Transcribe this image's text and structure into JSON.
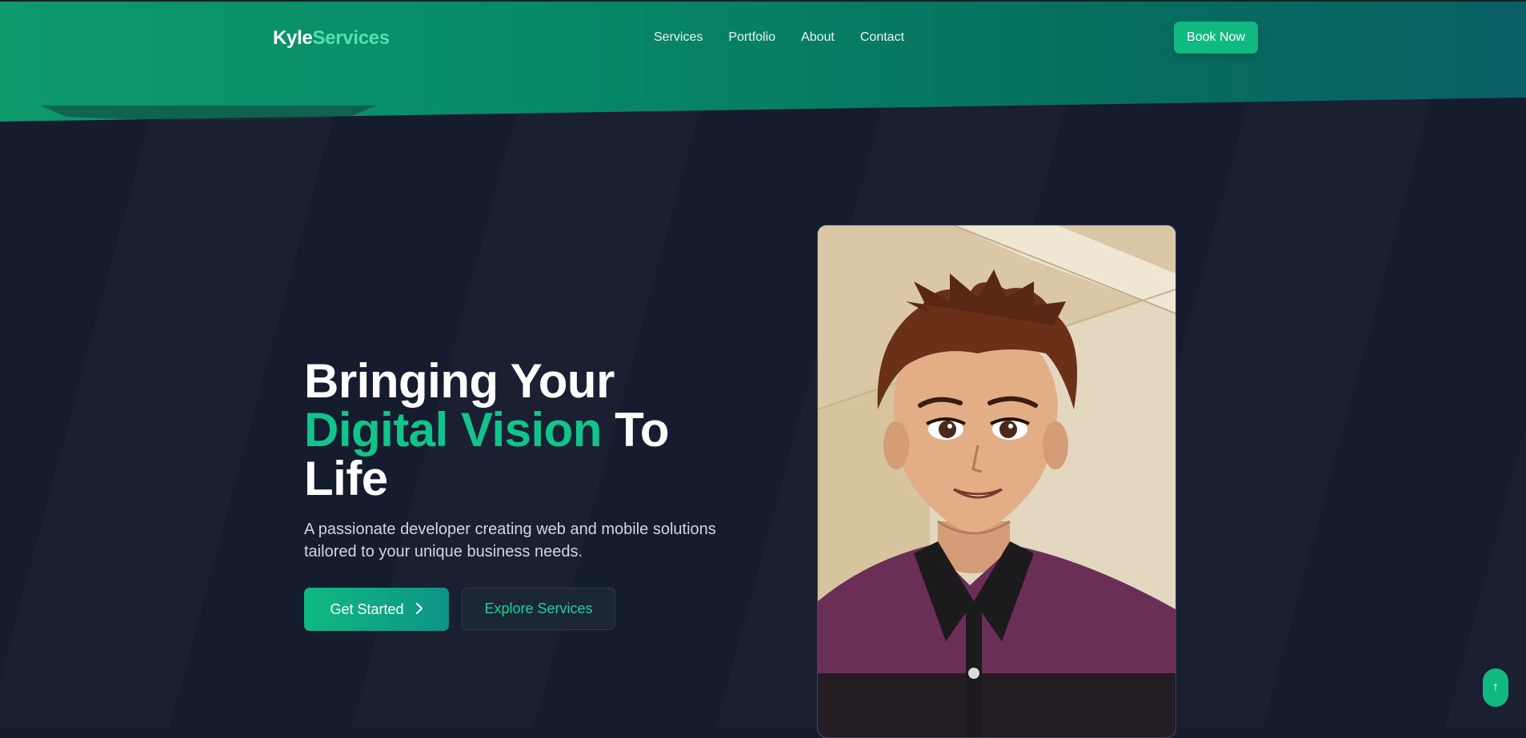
{
  "brand": {
    "part1": "Kyle",
    "part2": "Services"
  },
  "nav": {
    "items": [
      "Services",
      "Portfolio",
      "About",
      "Contact"
    ],
    "cta": "Book Now"
  },
  "hero": {
    "title_line1": "Bringing Your",
    "title_accent": "Digital Vision",
    "title_after_accent": " To",
    "title_line3": "Life",
    "subtitle": "A passionate developer creating web and mobile solutions tailored to your unique business needs.",
    "primary_button": "Get Started",
    "secondary_button": "Explore Services"
  },
  "icons": {
    "primary_button_icon": "chevron-right-icon",
    "scroll_top_icon": "arrow-up-icon"
  },
  "scroll_top_label": "↑",
  "colors": {
    "accent": "#10b981",
    "background": "#151c2e",
    "header_start": "#0d9a6d",
    "header_end": "#0a5f64"
  }
}
